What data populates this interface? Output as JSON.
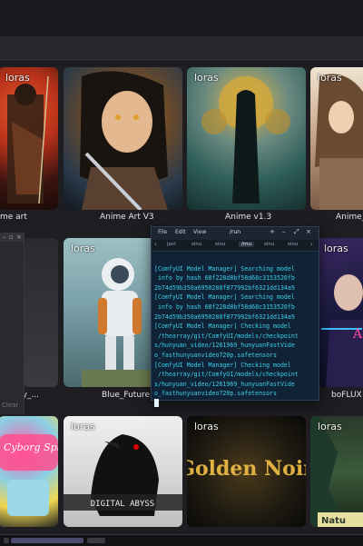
{
  "badge_text": "loras",
  "row1": [
    {
      "name": "me art",
      "art": "samurai",
      "badge": true
    },
    {
      "name": "Anime Art V3",
      "art": "anime",
      "badge": false
    },
    {
      "name": "Anime v1.3",
      "art": "v13",
      "badge": true
    },
    {
      "name": "Anime_",
      "art": "anime2",
      "badge": true
    }
  ],
  "row2": [
    {
      "name": "raphy_...",
      "art": "photo",
      "badge": false
    },
    {
      "name": "Blue_Future",
      "art": "blue",
      "badge": true
    },
    {
      "name": "boFLUX",
      "art": "boflux",
      "badge": true
    }
  ],
  "row3": [
    {
      "name": "",
      "art": "cyborg",
      "badge": false,
      "title": "Cyborg Splash"
    },
    {
      "name": "",
      "art": "abyss",
      "badge": true,
      "title": "DIGITAL ABYSS"
    },
    {
      "name": "",
      "art": "noir",
      "badge": true,
      "title": "Golden Noir"
    },
    {
      "name": "",
      "art": "nature",
      "badge": true,
      "title": "Natu"
    }
  ],
  "left_panel": {
    "clear_label": "Clear"
  },
  "terminal": {
    "menu": [
      "File",
      "Edit",
      "View"
    ],
    "title": "/run",
    "tabs": [
      "javi",
      "sinu",
      "sinu",
      "/rnu",
      "sinu",
      "sinu"
    ],
    "active_tab": 3,
    "lines": [
      "[ComfyUI Model Manager] Searching model",
      " info by hash 68f228d8bf58d68c3153520fb",
      "2b74d59b350a6950288f877992bf6321dd134a9",
      "[ComfyUI Model Manager] Searching model",
      " info by hash 68f228d8bf58d68c3153520fb",
      "2b74d59b350a6950288f877992bf6321dd134a9",
      "[ComfyUI Model Manager] Checking model",
      " /thearray/git/ComfyUI/models/checkpoint",
      "s/hunyuan_video/1261969_hunyuanFastVide",
      "o_fasthunyuanvideo720p.safetensors",
      "[ComfyUI Model Manager] Checking model",
      " /thearray/git/ComfyUI/models/checkpoint",
      "s/hunyuan_video/1261969_hunyuanFastVide",
      "o_fasthunyuanvideo720p.safetensors"
    ]
  }
}
